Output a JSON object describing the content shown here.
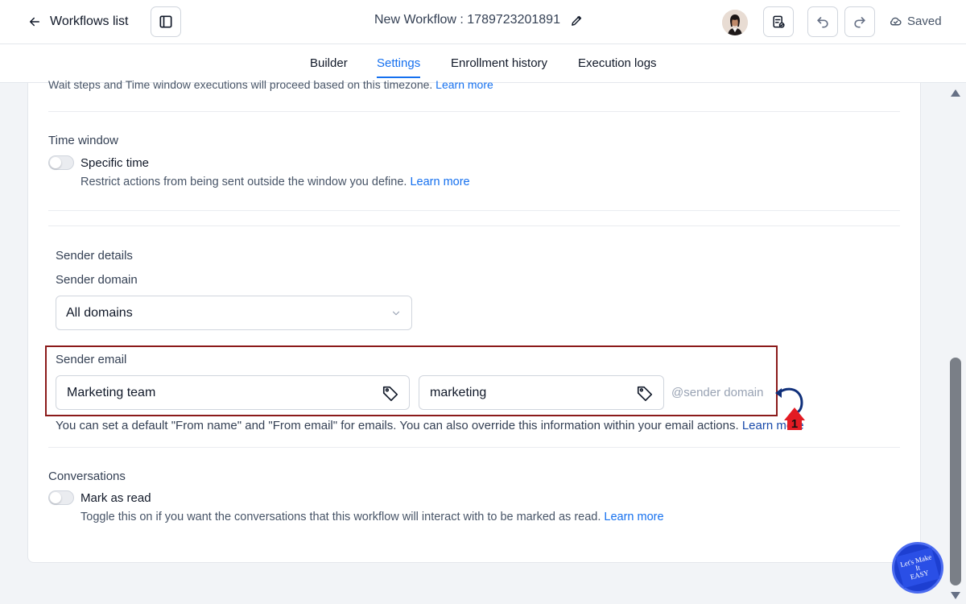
{
  "header": {
    "back_label": "Workflows list",
    "workflow_title": "New Workflow : 1789723201891",
    "saved_label": "Saved"
  },
  "tabs": [
    {
      "label": "Builder",
      "active": false
    },
    {
      "label": "Settings",
      "active": true
    },
    {
      "label": "Enrollment history",
      "active": false
    },
    {
      "label": "Execution logs",
      "active": false
    }
  ],
  "timezone": {
    "help_text": "Wait steps and Time window executions will proceed based on this timezone.",
    "learn_more": "Learn more"
  },
  "time_window": {
    "section_label": "Time window",
    "toggle_label": "Specific time",
    "toggle_on": false,
    "help_text": "Restrict actions from being sent outside the window you define.",
    "learn_more": "Learn more"
  },
  "sender": {
    "section_label": "Sender details",
    "domain_label": "Sender domain",
    "domain_value": "All domains",
    "email_label": "Sender email",
    "from_name_value": "Marketing team",
    "from_email_value": "marketing",
    "domain_suffix": "@sender domain",
    "help_text": "You can set a default \"From name\" and \"From email\" for emails. You can also override this information within your email actions.",
    "learn_more": "Learn more"
  },
  "conversations": {
    "section_label": "Conversations",
    "toggle_label": "Mark as read",
    "toggle_on": false,
    "help_text": "Toggle this on if you want the conversations that this workflow will interact with to be marked as read.",
    "learn_more": "Learn more"
  },
  "annotation": {
    "step_number": "1",
    "highlight_color": "#8b1a1a",
    "marker_color": "#e31b23"
  },
  "watermark": {
    "line1": "Let's Make",
    "line2": "It",
    "line3": "EASY"
  },
  "colors": {
    "accent": "#1570ef",
    "link_dark": "#1849a9",
    "border": "#d0d5dd"
  },
  "icons": [
    "arrow-left-icon",
    "sidebar-toggle-icon",
    "pencil-icon",
    "clipboard-check-icon",
    "undo-icon",
    "redo-icon",
    "cloud-check-icon",
    "chevron-down-icon",
    "tag-icon",
    "curved-arrow-icon"
  ]
}
